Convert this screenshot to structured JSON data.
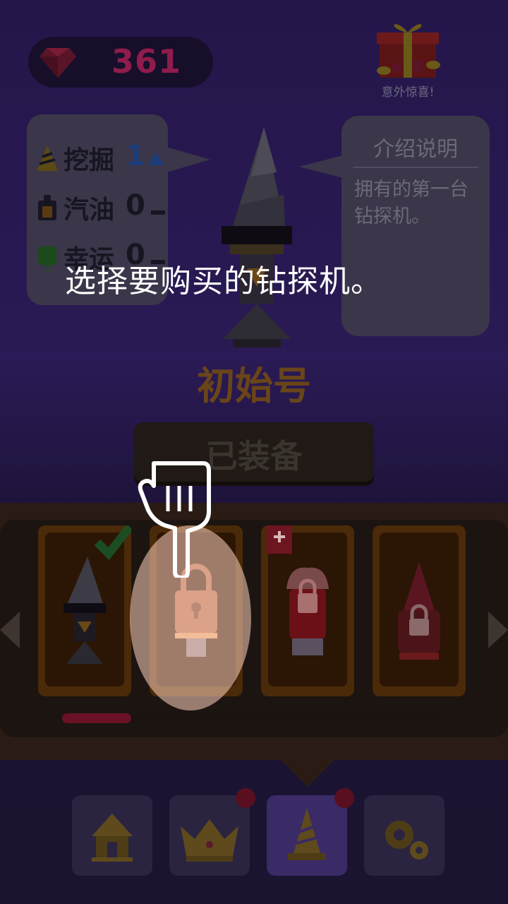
{
  "top": {
    "gems": "361",
    "gift_label": "意外惊喜!"
  },
  "stats": {
    "rows": [
      {
        "icon": "drill-icon",
        "label": "挖掘",
        "value": "1",
        "trend": "up"
      },
      {
        "icon": "fuel-can-icon",
        "label": "汽油",
        "value": "0",
        "trend": "none"
      },
      {
        "icon": "clover-icon",
        "label": "幸运",
        "value": "0",
        "trend": "none"
      }
    ]
  },
  "intro": {
    "title": "介绍说明",
    "text": "拥有的第一台钻探机。"
  },
  "drill": {
    "name": "初始号",
    "equip_label": "已装备"
  },
  "shelf": {
    "cards": [
      {
        "state": "equipped"
      },
      {
        "state": "locked"
      },
      {
        "state": "locked"
      },
      {
        "state": "locked"
      }
    ],
    "scroll_fraction": 0.18
  },
  "tutorial": {
    "tip": "选择要购买的钻探机。"
  },
  "nav": {
    "items": [
      {
        "icon": "home-icon",
        "badge": false
      },
      {
        "icon": "crown-icon",
        "badge": true
      },
      {
        "icon": "drill-icon",
        "badge": true,
        "active": true
      },
      {
        "icon": "gear-icon",
        "badge": false
      }
    ]
  },
  "colors": {
    "overlay_text": "#ffffff",
    "gem": "#8f1c4c",
    "card": "#4a2a08"
  }
}
